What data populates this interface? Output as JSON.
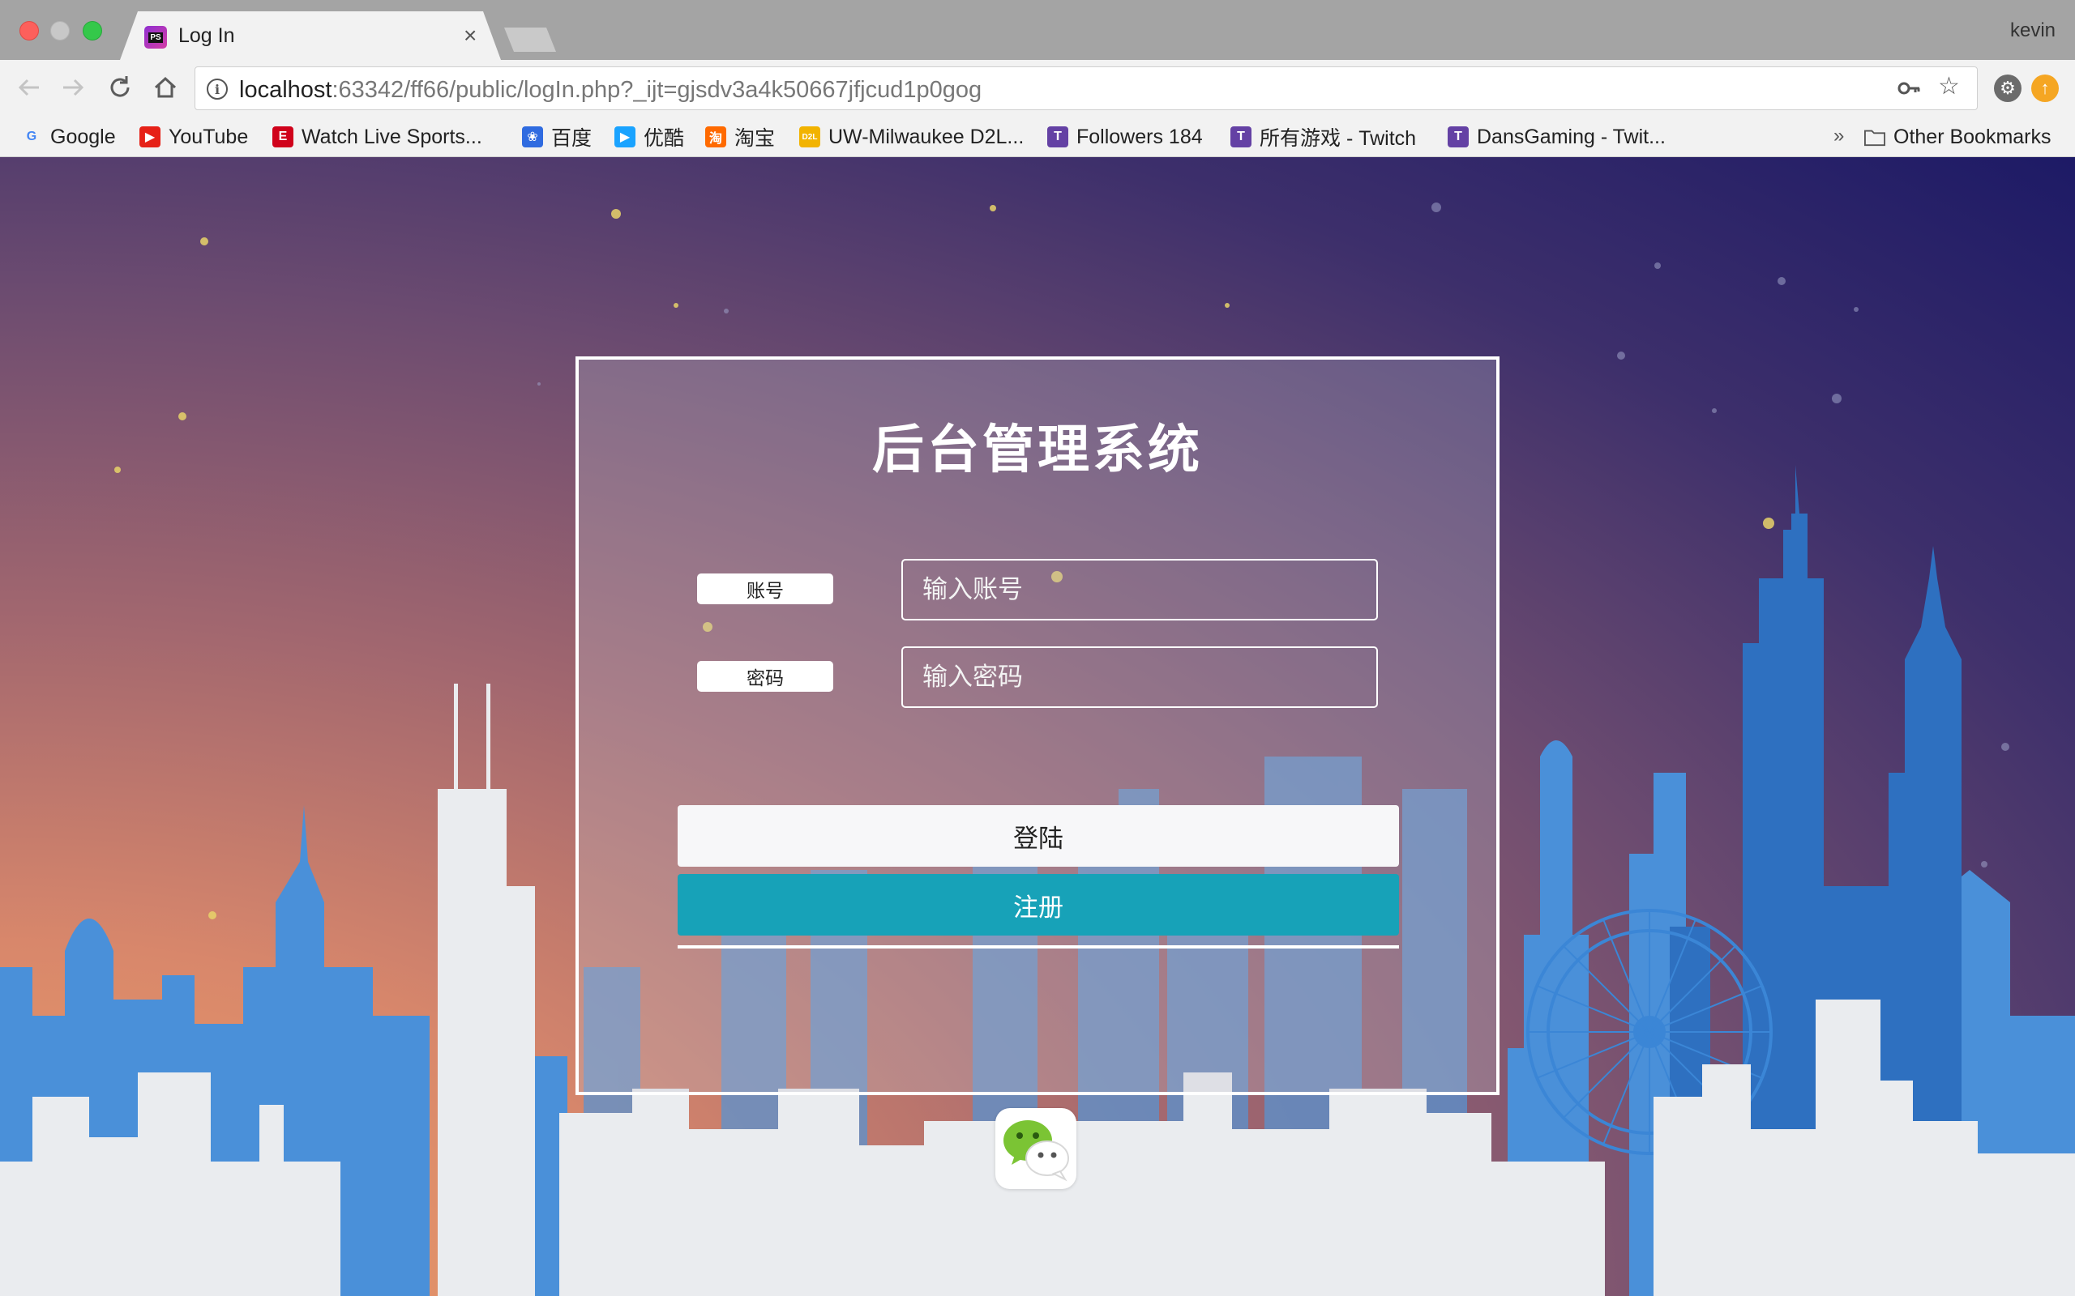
{
  "browser": {
    "tab": {
      "title": "Log In",
      "favicon": "phpstorm-icon",
      "favicon_text": "PS"
    },
    "profile_name": "kevin",
    "url": {
      "host": "localhost",
      "rest": ":63342/ff66/public/logIn.php?_ijt=gjsdv3a4k50667jfjcud1p0gog"
    },
    "bookmarks": [
      {
        "label": "Google",
        "icon": "google-icon",
        "glyph": "G",
        "color": "#4285f4"
      },
      {
        "label": "YouTube",
        "icon": "youtube-icon",
        "glyph": "▶",
        "color": "#e62117"
      },
      {
        "label": "Watch Live Sports...",
        "icon": "espn-icon",
        "glyph": "E",
        "color": "#d0021b"
      },
      {
        "label": "百度",
        "icon": "baidu-paw-icon",
        "glyph": "❀",
        "color": "#2f6be0"
      },
      {
        "label": "优酷",
        "icon": "youku-icon",
        "glyph": "▶",
        "color": "#1aa3ff"
      },
      {
        "label": "淘宝",
        "icon": "taobao-icon",
        "glyph": "淘",
        "color": "#ff6a00"
      },
      {
        "label": "UW-Milwaukee D2L...",
        "icon": "d2l-icon",
        "glyph": "D2L",
        "color": "#f2b300"
      },
      {
        "label": "Followers 184",
        "icon": "twitch-icon",
        "glyph": "T",
        "color": "#6441a4"
      },
      {
        "label": "所有游戏 - Twitch",
        "icon": "twitch-icon",
        "glyph": "T",
        "color": "#6441a4"
      },
      {
        "label": "DansGaming - Twit...",
        "icon": "twitch-icon",
        "glyph": "T",
        "color": "#6441a4"
      }
    ],
    "other_bookmarks": "Other Bookmarks",
    "overflow_glyph": "»"
  },
  "login": {
    "title": "后台管理系统",
    "account_label": "账号",
    "account_placeholder": "输入账号",
    "password_label": "密码",
    "password_placeholder": "输入密码",
    "login_button": "登陆",
    "register_button": "注册"
  }
}
